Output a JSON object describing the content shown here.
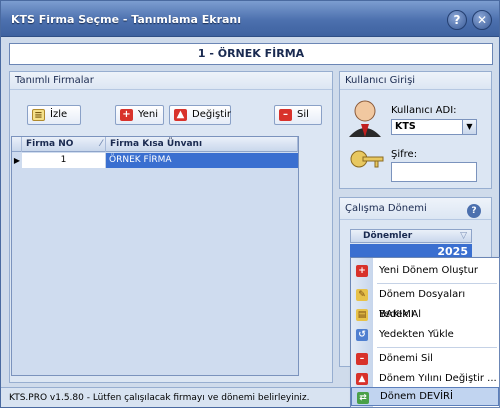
{
  "window": {
    "title": "KTS Firma Seçme - Tanımlama Ekranı"
  },
  "firm_header": "1 - ÖRNEK FİRMA",
  "left_group": {
    "title": "Tanımlı Firmalar",
    "buttons": {
      "view": "İzle",
      "new": "Yeni",
      "edit": "Değiştir",
      "delete": "Sil"
    },
    "grid": {
      "columns": [
        "Firma NO",
        "Firma Kısa Ünvanı"
      ],
      "rows": [
        {
          "no": "1",
          "name": "ÖRNEK FİRMA"
        }
      ]
    }
  },
  "login_group": {
    "title": "Kullanıcı Girişi",
    "username_label": "Kullanıcı ADI:",
    "username_value": "KTS",
    "password_label": "Şifre:"
  },
  "period_group": {
    "title": "Çalışma Dönemi",
    "column": "Dönemler",
    "year": "2025"
  },
  "context_menu": {
    "items": [
      "Yeni Dönem Oluştur",
      "Dönem Dosyaları BAKIMI",
      "Yedek Al",
      "Yedekten Yükle",
      "Dönemi Sil",
      "Dönem Yılını Değiştir ...",
      "Dönem DEVİRİ"
    ]
  },
  "status": "KTS.PRO v1.5.80 - Lütfen çalışılacak firmayı ve dönemi belirleyiniz.",
  "colors": {
    "accent": "#4c70ae",
    "selection": "#3a6fd0",
    "red": "#d8322b"
  }
}
